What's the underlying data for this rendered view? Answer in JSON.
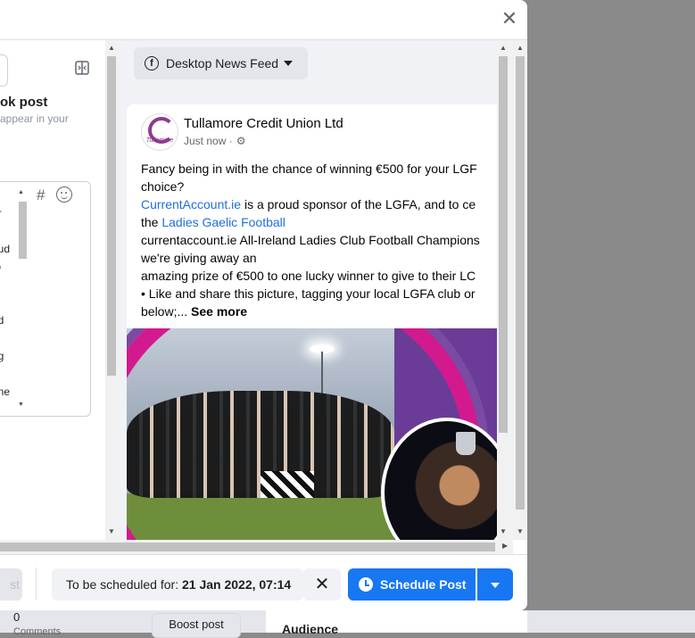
{
  "background": {
    "count": "0",
    "comments_label": "Comments",
    "boost_label": "Boost post",
    "audience_label": "Audience"
  },
  "modal": {
    "close_icon": "close-icon"
  },
  "editor": {
    "title": "ok post",
    "subtitle": "appear in your",
    "text_fragments": [
      "or",
      "oud",
      "to",
      "ic",
      "nd",
      "ng",
      "one",
      "ic"
    ],
    "hashtag_icon": "#",
    "emoji_icon": "emoji-icon"
  },
  "preview": {
    "placement_label": "Desktop News Feed",
    "post": {
      "page_name": "Tullamore Credit Union Ltd",
      "timestamp": "Just now ·",
      "avatar_text": "Tullamore",
      "lines": [
        {
          "parts": [
            {
              "text": "Fancy being in with the chance of winning €500 for your LGF"
            }
          ]
        },
        {
          "parts": [
            {
              "text": "choice?"
            }
          ]
        },
        {
          "parts": [
            {
              "text": "CurrentAccount.ie",
              "link": true
            },
            {
              "text": "  is a proud sponsor of the LGFA, and to ce"
            }
          ]
        },
        {
          "parts": [
            {
              "text": "the "
            },
            {
              "text": "Ladies Gaelic Football",
              "link": true
            }
          ]
        },
        {
          "parts": [
            {
              "text": "currentaccount.ie All-Ireland Ladies Club Football Champions"
            }
          ]
        },
        {
          "parts": [
            {
              "text": "we're giving away an"
            }
          ]
        },
        {
          "parts": [
            {
              "text": "amazing prize of €500 to one lucky winner to give to their LC"
            }
          ]
        },
        {
          "parts": [
            {
              "text": "• Like and share this picture, tagging your local LGFA club or"
            }
          ]
        },
        {
          "parts": [
            {
              "text": "below;... "
            },
            {
              "text": "See more",
              "bold": true
            }
          ]
        }
      ]
    }
  },
  "footer": {
    "stub_label": "st",
    "schedule_prefix": "To be scheduled for: ",
    "schedule_date": "21 Jan 2022, 07:14",
    "clear_icon": "✕",
    "schedule_button": "Schedule Post"
  }
}
